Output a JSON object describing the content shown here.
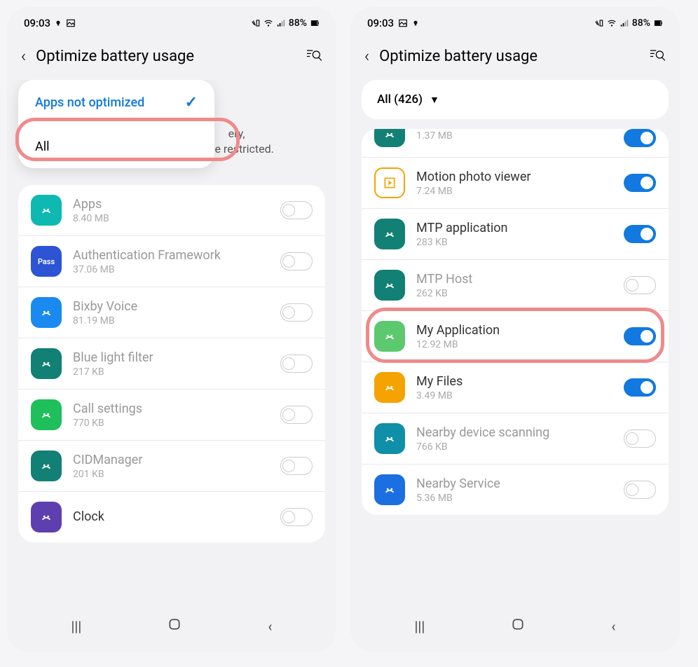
{
  "status": {
    "time": "09:03",
    "battery": "88%"
  },
  "header": {
    "title": "Optimize battery usage"
  },
  "left": {
    "dropdown": {
      "selected": "Apps not optimized",
      "other": "All"
    },
    "desc_partial": "but some background functions will be restricted.",
    "desc_trail": "ery,",
    "apps": [
      {
        "name": "Apps",
        "size": "8.40 MB",
        "dim": true,
        "icon_bg": "#0db9b0",
        "on": false
      },
      {
        "name": "Authentication Framework",
        "size": "37.06 MB",
        "dim": true,
        "icon_bg": "#2c54d4",
        "icon_text": "Pass",
        "on": false
      },
      {
        "name": "Bixby Voice",
        "size": "81.19 MB",
        "dim": true,
        "icon_bg": "#1b8af0",
        "on": false
      },
      {
        "name": "Blue light filter",
        "size": "217 KB",
        "dim": true,
        "icon_bg": "#128074",
        "on": false
      },
      {
        "name": "Call settings",
        "size": "770 KB",
        "dim": true,
        "icon_bg": "#1fbf5c",
        "on": false
      },
      {
        "name": "CIDManager",
        "size": "201 KB",
        "dim": true,
        "icon_bg": "#128074",
        "on": false
      },
      {
        "name": "Clock",
        "size": "",
        "dim": false,
        "icon_bg": "#5e3fb0",
        "on": false
      }
    ]
  },
  "right": {
    "filter_label": "All (426)",
    "apps": [
      {
        "name": "",
        "size": "1.37 MB",
        "dim": false,
        "icon_bg": "#128074",
        "on": true,
        "partial": true
      },
      {
        "name": "Motion photo viewer",
        "size": "7.24 MB",
        "dim": false,
        "icon_bg": "#ffffff",
        "icon_border": "#f5a300",
        "on": true
      },
      {
        "name": "MTP application",
        "size": "283 KB",
        "dim": false,
        "icon_bg": "#128074",
        "on": true
      },
      {
        "name": "MTP Host",
        "size": "262 KB",
        "dim": true,
        "icon_bg": "#128074",
        "on": false
      },
      {
        "name": "My Application",
        "size": "12.92 MB",
        "dim": false,
        "icon_bg": "#5cc96e",
        "on": true,
        "highlight": true
      },
      {
        "name": "My Files",
        "size": "3.49 MB",
        "dim": false,
        "icon_bg": "#f5a300",
        "on": true
      },
      {
        "name": "Nearby device scanning",
        "size": "766 KB",
        "dim": true,
        "icon_bg": "#0f8fa8",
        "on": false
      },
      {
        "name": "Nearby Service",
        "size": "5.36 MB",
        "dim": true,
        "icon_bg": "#1b6fe0",
        "on": false
      }
    ]
  },
  "colors": {
    "accent": "#1279e0",
    "highlight": "#f08a8a"
  }
}
